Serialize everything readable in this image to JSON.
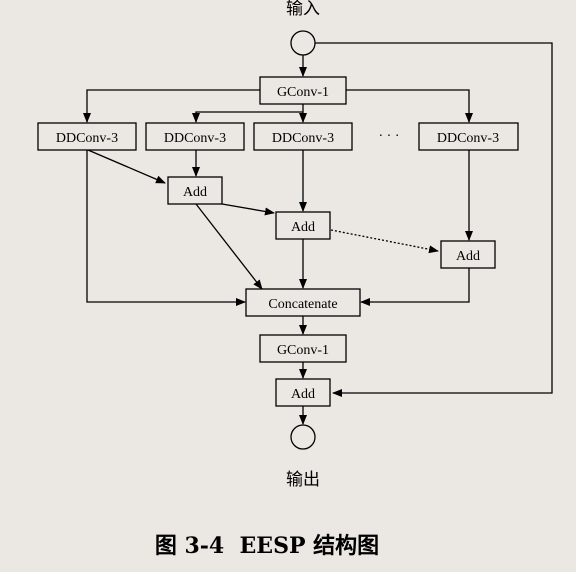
{
  "input_label": "输入",
  "output_label": "输出",
  "ellipsis": "· · ·",
  "nodes": {
    "gconv_top": "GConv-1",
    "ddconv_1": "DDConv-3",
    "ddconv_2": "DDConv-3",
    "ddconv_3": "DDConv-3",
    "ddconv_n": "DDConv-3",
    "add_1": "Add",
    "add_2": "Add",
    "add_n": "Add",
    "concatenate": "Concatenate",
    "gconv_bottom": "GConv-1",
    "add_out": "Add"
  },
  "caption": "图 3-4  EESP 结构图"
}
